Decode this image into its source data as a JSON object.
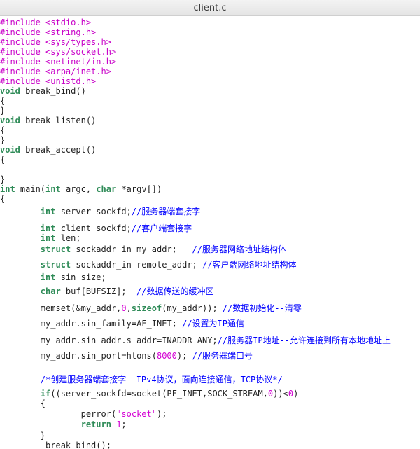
{
  "window": {
    "title": "client.c"
  },
  "colors": {
    "preprocessor": "#c800c8",
    "keyword": "#2e8b57",
    "number_string": "#d400d4",
    "comment": "#0000ff",
    "text": "#222222"
  },
  "code": {
    "lines": [
      [
        {
          "c": "pp",
          "t": "#include <stdio.h>"
        }
      ],
      [
        {
          "c": "pp",
          "t": "#include <string.h>"
        }
      ],
      [
        {
          "c": "pp",
          "t": "#include <sys/types.h>"
        }
      ],
      [
        {
          "c": "pp",
          "t": "#include <sys/socket.h>"
        }
      ],
      [
        {
          "c": "pp",
          "t": "#include <netinet/in.h>"
        }
      ],
      [
        {
          "c": "pp",
          "t": "#include <arpa/inet.h>"
        }
      ],
      [
        {
          "c": "pp",
          "t": "#include <unistd.h>"
        }
      ],
      [
        {
          "c": "ty",
          "t": "void"
        },
        {
          "c": "",
          "t": " break_bind()"
        }
      ],
      [
        {
          "c": "",
          "t": "{"
        }
      ],
      [
        {
          "c": "",
          "t": "}"
        }
      ],
      [
        {
          "c": "ty",
          "t": "void"
        },
        {
          "c": "",
          "t": " break_listen()"
        }
      ],
      [
        {
          "c": "",
          "t": "{"
        }
      ],
      [
        {
          "c": "",
          "t": "}"
        }
      ],
      [
        {
          "c": "ty",
          "t": "void"
        },
        {
          "c": "",
          "t": " break_accept()"
        }
      ],
      [
        {
          "c": "",
          "t": "{"
        }
      ],
      [
        {
          "c": "",
          "t": ""
        }
      ],
      [
        {
          "c": "",
          "t": "}"
        }
      ],
      [
        {
          "c": "ty",
          "t": "int"
        },
        {
          "c": "",
          "t": " main("
        },
        {
          "c": "ty",
          "t": "int"
        },
        {
          "c": "",
          "t": " argc, "
        },
        {
          "c": "ty",
          "t": "char"
        },
        {
          "c": "",
          "t": " *argv[])"
        }
      ],
      [
        {
          "c": "",
          "t": "{"
        }
      ],
      [
        {
          "c": "",
          "t": "        "
        },
        {
          "c": "ty",
          "t": "int"
        },
        {
          "c": "",
          "t": " server_sockfd;"
        },
        {
          "c": "cm",
          "t": "//服务器端套接字"
        }
      ],
      [
        {
          "c": "",
          "t": "        "
        },
        {
          "c": "ty",
          "t": "int"
        },
        {
          "c": "",
          "t": " client_sockfd;"
        },
        {
          "c": "cm",
          "t": "//客户端套接字"
        }
      ],
      [
        {
          "c": "",
          "t": "        "
        },
        {
          "c": "ty",
          "t": "int"
        },
        {
          "c": "",
          "t": " len;"
        }
      ],
      [
        {
          "c": "",
          "t": "        "
        },
        {
          "c": "ty",
          "t": "struct"
        },
        {
          "c": "",
          "t": " sockaddr_in my_addr;   "
        },
        {
          "c": "cm",
          "t": "//服务器网络地址结构体"
        }
      ],
      [
        {
          "c": "",
          "t": "        "
        },
        {
          "c": "ty",
          "t": "struct"
        },
        {
          "c": "",
          "t": " sockaddr_in remote_addr; "
        },
        {
          "c": "cm",
          "t": "//客户端网络地址结构体"
        }
      ],
      [
        {
          "c": "",
          "t": "        "
        },
        {
          "c": "ty",
          "t": "int"
        },
        {
          "c": "",
          "t": " sin_size;"
        }
      ],
      [
        {
          "c": "",
          "t": "        "
        },
        {
          "c": "ty",
          "t": "char"
        },
        {
          "c": "",
          "t": " buf[BUFSIZ];  "
        },
        {
          "c": "cm",
          "t": "//数据传送的缓冲区"
        }
      ],
      [
        {
          "c": "",
          "t": "        memset(&my_addr,"
        },
        {
          "c": "num",
          "t": "0"
        },
        {
          "c": "",
          "t": ","
        },
        {
          "c": "kw",
          "t": "sizeof"
        },
        {
          "c": "",
          "t": "(my_addr)); "
        },
        {
          "c": "cm",
          "t": "//数据初始化--清零"
        }
      ],
      [
        {
          "c": "",
          "t": "        my_addr.sin_family=AF_INET; "
        },
        {
          "c": "cm",
          "t": "//设置为IP通信"
        }
      ],
      [
        {
          "c": "",
          "t": "        my_addr.sin_addr.s_addr=INADDR_ANY;"
        },
        {
          "c": "cm",
          "t": "//服务器IP地址--允许连接到所有本地地址上"
        }
      ],
      [
        {
          "c": "",
          "t": "        my_addr.sin_port=htons("
        },
        {
          "c": "num",
          "t": "8000"
        },
        {
          "c": "",
          "t": "); "
        },
        {
          "c": "cm",
          "t": "//服务器端口号"
        }
      ],
      [
        {
          "c": "",
          "t": ""
        }
      ],
      [
        {
          "c": "",
          "t": "        "
        },
        {
          "c": "cm",
          "t": "/*创建服务器端套接字--IPv4协议，面向连接通信，TCP协议*/"
        }
      ],
      [
        {
          "c": "",
          "t": "        "
        },
        {
          "c": "kw",
          "t": "if"
        },
        {
          "c": "",
          "t": "((server_sockfd=socket(PF_INET,SOCK_STREAM,"
        },
        {
          "c": "num",
          "t": "0"
        },
        {
          "c": "",
          "t": "))<"
        },
        {
          "c": "num",
          "t": "0"
        },
        {
          "c": "",
          "t": ")"
        }
      ],
      [
        {
          "c": "",
          "t": "        {"
        }
      ],
      [
        {
          "c": "",
          "t": "                perror("
        },
        {
          "c": "str",
          "t": "\"socket\""
        },
        {
          "c": "",
          "t": ");"
        }
      ],
      [
        {
          "c": "",
          "t": "                "
        },
        {
          "c": "kw",
          "t": "return"
        },
        {
          "c": "",
          "t": " "
        },
        {
          "c": "num",
          "t": "1"
        },
        {
          "c": "",
          "t": ";"
        }
      ],
      [
        {
          "c": "",
          "t": "        }"
        }
      ],
      [
        {
          "c": "",
          "t": "         break_bind();"
        }
      ]
    ]
  }
}
